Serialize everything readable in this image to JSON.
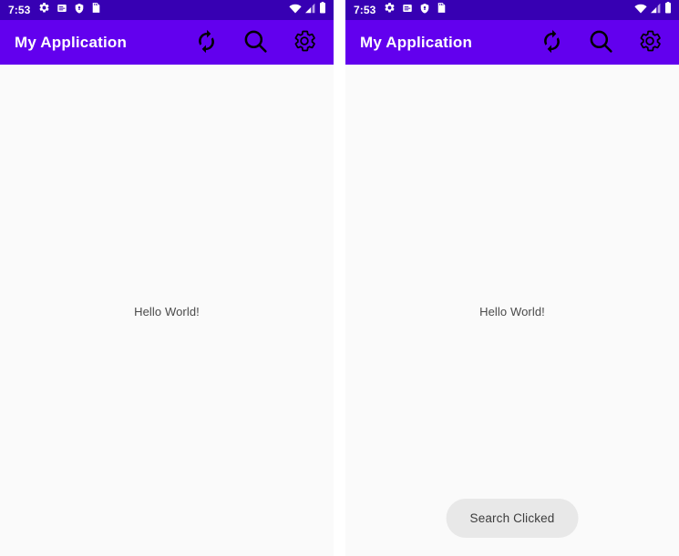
{
  "screens": [
    {
      "id": "screen-initial",
      "status_bar": {
        "time": "7:53",
        "left_icons": [
          "gear-icon",
          "notes-icon",
          "shield-icon",
          "sd-card-icon"
        ],
        "right_icons": [
          "wifi-icon",
          "cellular-signal-icon",
          "battery-icon"
        ]
      },
      "toolbar": {
        "title": "My Application",
        "actions": [
          {
            "name": "refresh-action",
            "icon": "refresh-icon"
          },
          {
            "name": "search-action",
            "icon": "search-icon"
          },
          {
            "name": "settings-action",
            "icon": "gear-icon"
          }
        ]
      },
      "content": {
        "hello_text": "Hello World!"
      },
      "toast": {
        "visible": false,
        "message": ""
      }
    },
    {
      "id": "screen-search-clicked",
      "status_bar": {
        "time": "7:53",
        "left_icons": [
          "gear-icon",
          "notes-icon",
          "shield-icon",
          "sd-card-icon"
        ],
        "right_icons": [
          "wifi-icon",
          "cellular-signal-icon",
          "battery-icon"
        ]
      },
      "toolbar": {
        "title": "My Application",
        "actions": [
          {
            "name": "refresh-action",
            "icon": "refresh-icon"
          },
          {
            "name": "search-action",
            "icon": "search-icon"
          },
          {
            "name": "settings-action",
            "icon": "gear-icon"
          }
        ]
      },
      "content": {
        "hello_text": "Hello World!"
      },
      "toast": {
        "visible": true,
        "message": "Search Clicked"
      }
    }
  ],
  "colors": {
    "status_bar": "#3700b3",
    "toolbar": "#6200ee",
    "toolbar_title": "#ffffff",
    "toolbar_icon": "#000000",
    "content_background": "#fafafa",
    "body_text": "#4a4a4a",
    "toast_background": "#e8e8e8",
    "toast_text": "#3c3c3c"
  }
}
